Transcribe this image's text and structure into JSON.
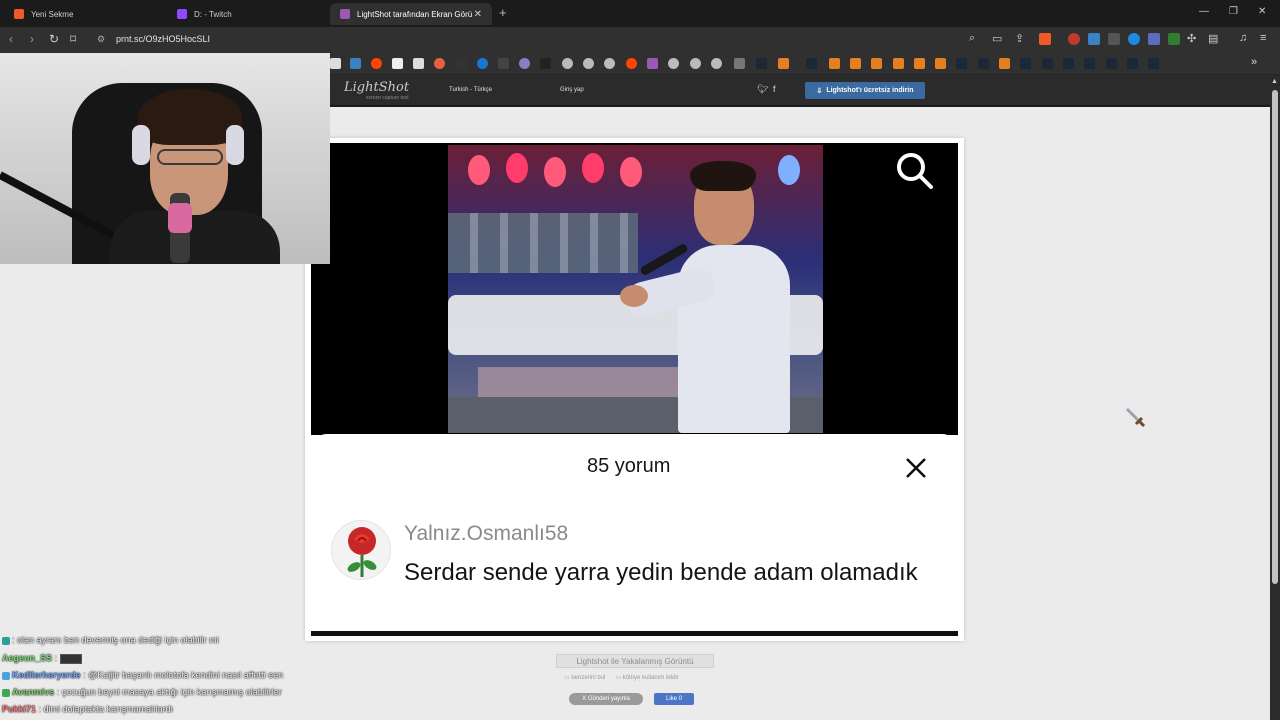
{
  "browser": {
    "tabs": [
      {
        "label": "Yeni Sekme",
        "icon_color": "#f05a28"
      },
      {
        "label": "D: - Twitch",
        "icon_color": "#9146ff"
      },
      {
        "label": "LightShot tarafından Ekran Görü",
        "icon_color": "#9b59b6",
        "active": true
      }
    ],
    "new_tab_glyph": "+",
    "url": "prnt.sc/O9zHO5HocSLI"
  },
  "lightshot": {
    "logo": "LightShot",
    "logo_sub": "screen capture tool",
    "language": "Turkish - Türkçe",
    "login": "Giriş yap",
    "download_button": "Lightshot'ı ücretsiz indirin",
    "caption": "Lightshot ile Yakalanmış Görüntü",
    "find_similar": "benzerini bul",
    "report_abuse": "kötüye kullanım bildir",
    "tweet_button": "Gönderi yayınla",
    "like_button": "Like 0"
  },
  "screenshot_content": {
    "comment_count": "85 yorum",
    "comment": {
      "username": "Yalnız.Osmanlı58",
      "text": "Serdar sende yarra yedin bende adam olamadık"
    }
  },
  "chat": [
    {
      "user": "",
      "user_color": "#9ad",
      "message": ": olan ayranı ben devermiş ona dediği için olabilir mi",
      "badge_color": "#2aa198"
    },
    {
      "user": "Aegeun_SS",
      "user_color": "#7fe07f",
      "message": ":",
      "badge_color": "",
      "emote": true
    },
    {
      "user": "Kedilerheryerde",
      "user_color": "#6fa8ff",
      "message": ": @Kaijitr başarılı molotofa kendini nasıl affetti een",
      "badge_color": "#4aa3df"
    },
    {
      "user": "Avanmivs",
      "user_color": "#7fd36b",
      "message": ": çocuğun beyni masaya aktığı için karışmamış olabilirler",
      "badge_color": "#3caa5a"
    },
    {
      "user": "Pukki71",
      "user_color": "#ff7b7b",
      "message": ": dimi dolaptakta karışmamalılardı",
      "badge_color": ""
    }
  ],
  "colors": {
    "page_bg": "#ebebeb",
    "header_bg": "#2b2b2b",
    "download_blue": "#3b6aa0",
    "fb_blue": "#4c75c5"
  }
}
